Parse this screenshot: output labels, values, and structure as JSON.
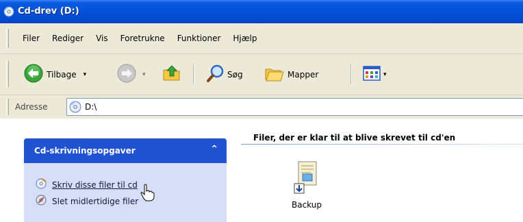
{
  "window": {
    "title": "Cd-drev (D:)",
    "title_icon": "cd-drive-icon"
  },
  "menu": {
    "items": [
      "Filer",
      "Rediger",
      "Vis",
      "Foretrukne",
      "Funktioner",
      "Hjælp"
    ]
  },
  "toolbar": {
    "back_label": "Tilbage",
    "back_icon": "back-arrow-icon",
    "forward_icon": "forward-arrow-icon",
    "up_icon": "up-folder-icon",
    "search_label": "Søg",
    "search_icon": "search-icon",
    "folders_label": "Mapper",
    "folders_icon": "folders-icon",
    "views_icon": "views-icon"
  },
  "address": {
    "label": "Adresse",
    "value": "D:\\",
    "icon": "cd-drive-icon"
  },
  "content": {
    "section_title": "Filer, der er klar til at blive skrevet til cd'en",
    "task_panel": {
      "title": "Cd-skrivningsopgaver",
      "collapse_glyph": "⌃",
      "tasks": [
        {
          "label": "Skriv disse filer til cd",
          "icon": "cd-write-icon"
        },
        {
          "label": "Slet midlertidige filer",
          "icon": "delete-temp-files-icon"
        }
      ]
    },
    "files": [
      {
        "name": "Backup",
        "icon": "file-pending-icon"
      }
    ]
  },
  "colors": {
    "titlebar": "#0551d6",
    "task_header": "#2152d1",
    "task_body": "#d6dff7",
    "chrome": "#ece9d8"
  }
}
